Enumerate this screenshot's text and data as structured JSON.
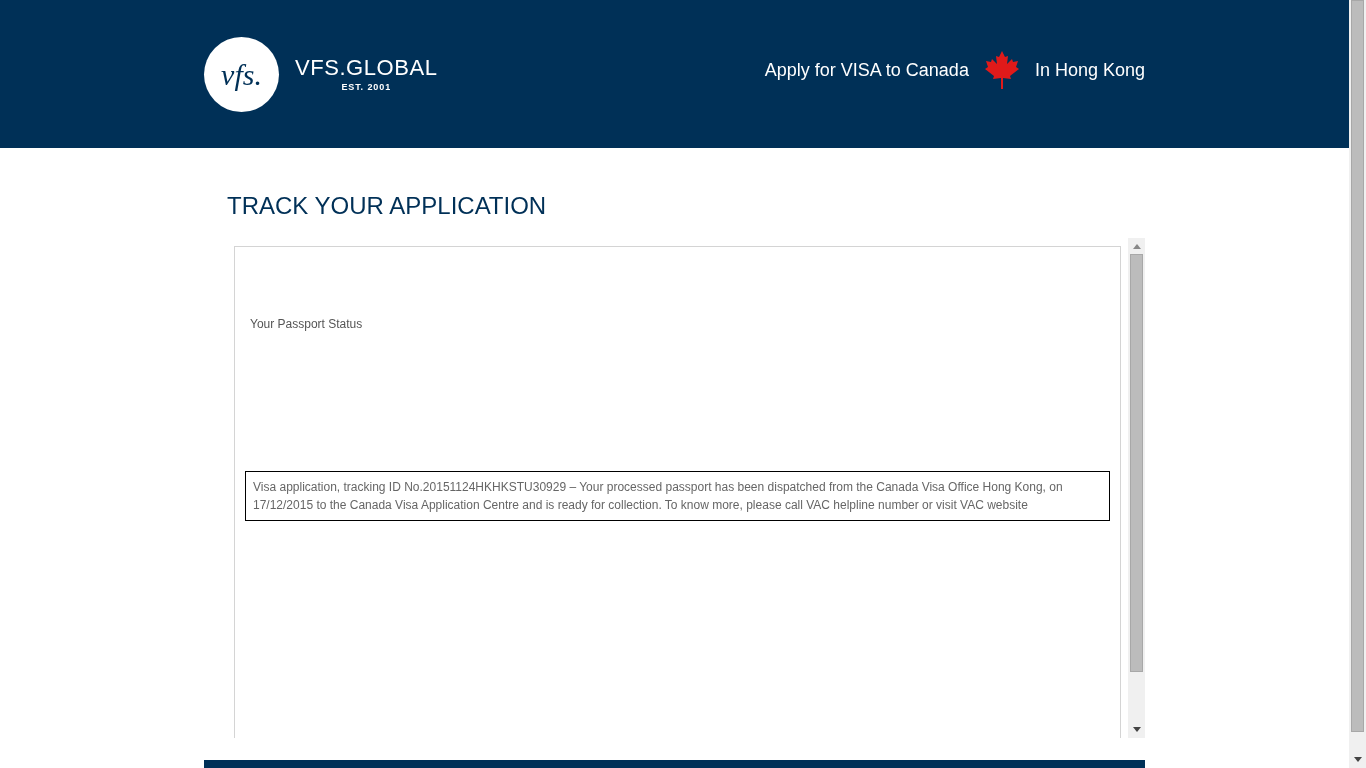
{
  "header": {
    "logo_mark": "vfs.",
    "logo_name": "VFS.GLOBAL",
    "logo_tagline": "EST. 2001",
    "apply_text": "Apply for VISA to Canada",
    "location_text": "In Hong Kong"
  },
  "page_title": "TRACK YOUR APPLICATION",
  "frame": {
    "status_label": "Your Passport Status",
    "status_message": "Visa application, tracking ID No.20151124HKHKSTU30929 – Your processed passport has been dispatched from the Canada Visa Office Hong Kong, on 17/12/2015 to the Canada Visa Application Centre and is ready for collection. To know more, please call VAC helpline number or visit VAC website"
  }
}
